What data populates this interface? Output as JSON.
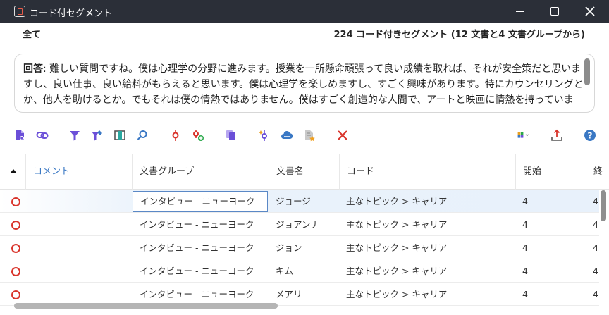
{
  "window": {
    "title": "コード付セグメント"
  },
  "header": {
    "scope": "全て",
    "summary": "224 コード付きセグメント (12 文書と4 文書グループから)"
  },
  "preview": {
    "label": "回答",
    "text": ": 難しい質問ですね。僕は心理学の分野に進みます。授業を一所懸命頑張って良い成績を取れば、それが安全策だと思いますし、良い仕事、良い給料がもらえると思います。僕は心理学を楽しめますし、すごく興味があります。特にカウンセリングとか、他人を助けるとか。でもそれは僕の情熱ではありません。僕はすごく創造的な人間で、アートと映画に情熱を持っています。職"
  },
  "toolbar": {
    "icons": [
      "document-code-icon",
      "link-chain-icon",
      "filter-icon",
      "filter-edit-icon",
      "column-panel-icon",
      "search-icon",
      "code-pin-icon",
      "add-code-icon",
      "copy-icon",
      "sparkle-code-icon",
      "cloud-icon",
      "document-star-icon",
      "delete-x-icon",
      "export-grid-icon",
      "upload-icon",
      "help-icon"
    ]
  },
  "table": {
    "columns": [
      "コメント",
      "文書グループ",
      "文書名",
      "コード",
      "開始",
      "終"
    ],
    "rows": [
      {
        "group": "インタビュー - ニューヨーク",
        "doc": "ジョージ",
        "code": "主なトピック > キャリア",
        "start": "4",
        "end": "4"
      },
      {
        "group": "インタビュー - ニューヨーク",
        "doc": "ジョアンナ",
        "code": "主なトピック > キャリア",
        "start": "4",
        "end": "4"
      },
      {
        "group": "インタビュー - ニューヨーク",
        "doc": "ジョン",
        "code": "主なトピック > キャリア",
        "start": "4",
        "end": "4"
      },
      {
        "group": "インタビュー - ニューヨーク",
        "doc": "キム",
        "code": "主なトピック > キャリア",
        "start": "4",
        "end": "4"
      },
      {
        "group": "インタビュー - ニューヨーク",
        "doc": "メアリ",
        "code": "主なトピック > キャリア",
        "start": "4",
        "end": "4"
      }
    ]
  },
  "colors": {
    "titlebar": "#2b2f38",
    "accent_blue": "#3a78c4",
    "accent_red": "#d9342b",
    "accent_purple": "#6b4fd8"
  }
}
